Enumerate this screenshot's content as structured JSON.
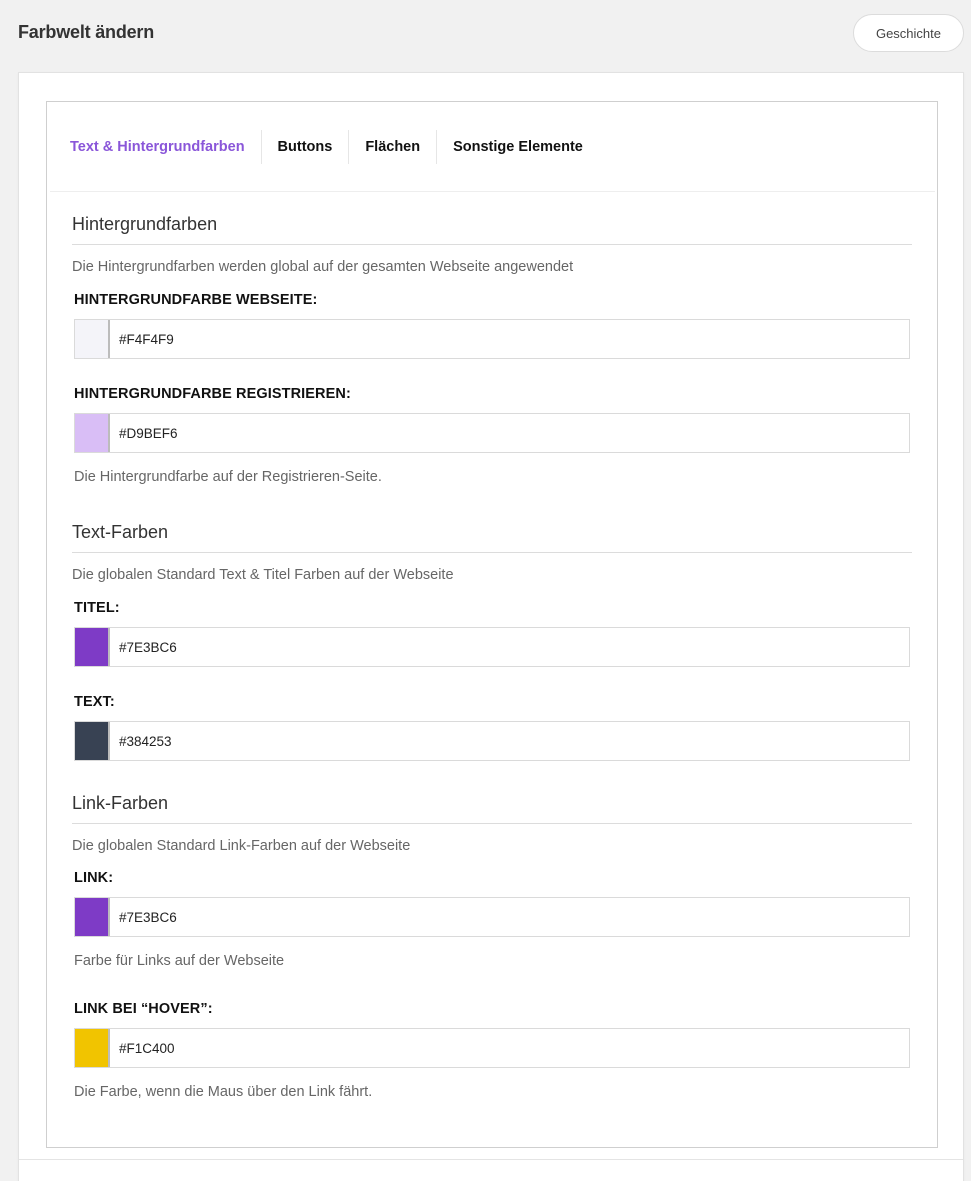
{
  "header": {
    "title": "Farbwelt ändern",
    "history_button": "Geschichte"
  },
  "tabs": [
    {
      "label": "Text & Hintergrundfarben",
      "active": true
    },
    {
      "label": "Buttons",
      "active": false
    },
    {
      "label": "Flächen",
      "active": false
    },
    {
      "label": "Sonstige Elemente",
      "active": false
    }
  ],
  "sections": {
    "background": {
      "title": "Hintergrundfarben",
      "description": "Die Hintergrundfarben werden global auf der gesamten Webseite angewendet",
      "fields": [
        {
          "label": "HINTERGRUNDFARBE WEBSEITE:",
          "value": "#F4F4F9",
          "swatch": "#F4F4F9"
        },
        {
          "label": "HINTERGRUNDFARBE REGISTRIEREN:",
          "value": "#D9BEF6",
          "swatch": "#D9BEF6",
          "help": "Die Hintergrundfarbe auf der Registrieren-Seite."
        }
      ]
    },
    "text": {
      "title": "Text-Farben",
      "description": "Die globalen Standard Text & Titel Farben auf der Webseite",
      "fields": [
        {
          "label": "TITEL:",
          "value": "#7E3BC6",
          "swatch": "#7E3BC6"
        },
        {
          "label": "TEXT:",
          "value": "#384253",
          "swatch": "#384253"
        }
      ]
    },
    "link": {
      "title": "Link-Farben",
      "description": "Die globalen Standard Link-Farben auf der Webseite",
      "fields": [
        {
          "label": "LINK:",
          "value": "#7E3BC6",
          "swatch": "#7E3BC6",
          "help": "Farbe für Links auf der Webseite"
        },
        {
          "label": "LINK BEI “HOVER”:",
          "value": "#F1C400",
          "swatch": "#F1C400",
          "help": "Die Farbe, wenn die Maus über den Link fährt."
        }
      ]
    }
  },
  "colors": {
    "accent": "#8A56D9",
    "page_background": "#F1F1F1"
  }
}
